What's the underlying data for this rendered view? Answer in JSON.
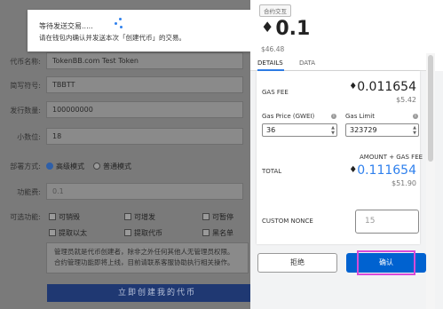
{
  "background_form": {
    "rows": [
      {
        "label": "代币名称:",
        "value": "TokenBB.com Test Token"
      },
      {
        "label": "简写符号:",
        "value": "TBBTT"
      },
      {
        "label": "发行数量:",
        "value": "100000000"
      },
      {
        "label": "小数位:",
        "value": "18"
      }
    ],
    "deploy_label": "部署方式:",
    "deploy_options": [
      "高级模式",
      "普通模式"
    ],
    "fee_label": "功能费:",
    "fee_value": "0.1",
    "features_label": "可选功能:",
    "features": [
      "可销毁",
      "可增发",
      "可暂停",
      "提取以太",
      "提取代币",
      "黑名单"
    ],
    "note_line1": "管理员就是代币创建者，除非之外任何其他人无管理员权限。",
    "note_line2": "合约管理功能即将上线，目前请联系客服协助执行相关操作。",
    "create_button": "立即创建我的代币"
  },
  "notification": {
    "title": "等待发送交易.....",
    "message": "请在钱包内确认并发送本次「创建代币」的交易。"
  },
  "metamask": {
    "badge": "合约交互",
    "amount": "0.1",
    "amount_usd": "$46.48",
    "tabs": [
      "DETAILS",
      "DATA"
    ],
    "gas_fee_label": "GAS FEE",
    "gas_fee_value": "0.011654",
    "gas_fee_usd": "$5.42",
    "gas_price_label": "Gas Price (GWEI)",
    "gas_price_value": "36",
    "gas_limit_label": "Gas Limit",
    "gas_limit_value": "323729",
    "amount_plus_gas_label": "AMOUNT + GAS FEE",
    "total_label": "TOTAL",
    "total_value": "0.111654",
    "total_usd": "$51.90",
    "custom_nonce_label": "CUSTOM NONCE",
    "custom_nonce_placeholder": "15",
    "reject_button": "拒绝",
    "confirm_button": "确认",
    "eth_icon": "ethereum-icon",
    "info_icon": "info-icon",
    "accent_color": "#2f80ed",
    "highlight_color": "#d84ad8"
  }
}
